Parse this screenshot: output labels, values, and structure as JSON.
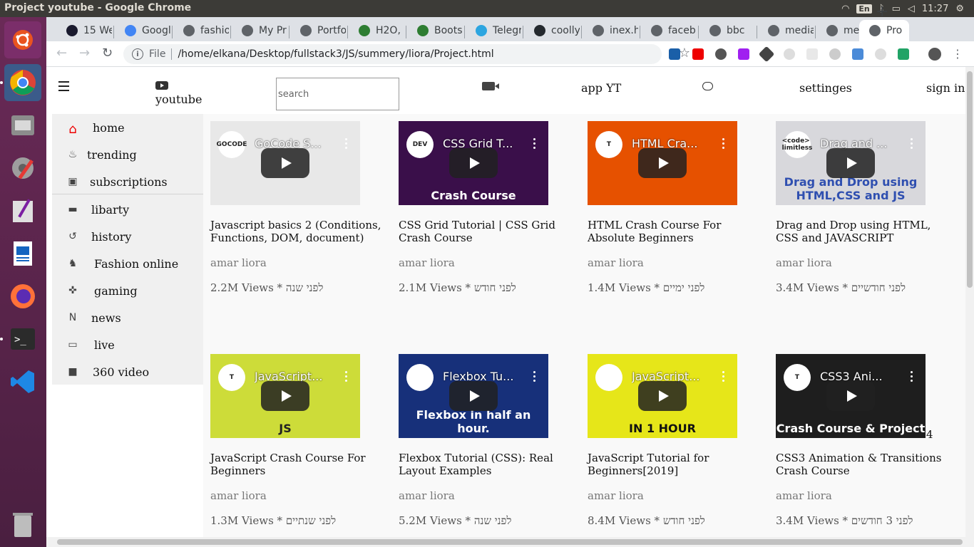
{
  "os": {
    "window_title": "Project youtube - Google Chrome",
    "keyboard": "En",
    "clock": "11:27"
  },
  "tabs": [
    {
      "label": "15 We",
      "color": "#1a1a2e"
    },
    {
      "label": "Googl",
      "color": "#4285f4"
    },
    {
      "label": "fashio",
      "color": "#5f6368"
    },
    {
      "label": "My Pr",
      "color": "#5f6368"
    },
    {
      "label": "Portfo",
      "color": "#5f6368"
    },
    {
      "label": "H2O, c",
      "color": "#2e7d32"
    },
    {
      "label": "Boots",
      "color": "#2e7d32"
    },
    {
      "label": "Telegr",
      "color": "#2ca5e0"
    },
    {
      "label": "coolly",
      "color": "#24292e"
    },
    {
      "label": "inex.h",
      "color": "#5f6368"
    },
    {
      "label": "faceb",
      "color": "#5f6368"
    },
    {
      "label": "bbc",
      "color": "#5f6368"
    },
    {
      "label": "media",
      "color": "#5f6368"
    },
    {
      "label": "media",
      "color": "#5f6368"
    },
    {
      "label": "Pro",
      "color": "#5f6368",
      "active": true
    }
  ],
  "omnibox": {
    "scheme": "File",
    "url": "/home/elkana/Desktop/fullstack3/JS/summery/liora/Project.html"
  },
  "page": {
    "logo_text": "youtube",
    "search_placeholder": "search",
    "nav": {
      "app": "app YT",
      "settings": "settinges",
      "signin": "sign in"
    },
    "sidebar": [
      {
        "label": "home",
        "icon": "home-icon"
      },
      {
        "label": "trending",
        "icon": "fire-icon"
      },
      {
        "label": "subscriptions",
        "icon": "subscriptions-icon"
      },
      {
        "label": "libarty",
        "icon": "folder-icon"
      },
      {
        "label": "history",
        "icon": "history-icon"
      },
      {
        "label": "Fashion online",
        "icon": "shirt-icon"
      },
      {
        "label": "gaming",
        "icon": "gamepad-icon"
      },
      {
        "label": "news",
        "icon": "news-icon"
      },
      {
        "label": "live",
        "icon": "monitor-icon"
      },
      {
        "label": "360 video",
        "icon": "video-camera-icon"
      }
    ],
    "videos": [
      {
        "thumb_title": "GoCode S...",
        "channel": "GOCODE",
        "thumb_sub": "",
        "title": "Javascript basics 2 (Conditions, Functions, DOM, document)",
        "author": "amar liora",
        "views": "2.2M Views * לפני שנה",
        "bg": "#e8e8e8",
        "sub_color": "#333"
      },
      {
        "thumb_title": "CSS Grid T...",
        "channel": "DEV",
        "thumb_sub": "Crash Course",
        "title": "CSS Grid Tutorial | CSS Grid Crash Course",
        "author": "amar liora",
        "views": "2.1M Views * לפני חודש",
        "bg": "#3a0f4a",
        "sub_color": "#fff"
      },
      {
        "thumb_title": "HTML Cra...",
        "channel": "T",
        "thumb_sub": "",
        "title": "HTML Crash Course For Absolute Beginners",
        "author": "amar liora",
        "views": "1.4M Views * לפני ימיים",
        "bg": "#e65100",
        "sub_color": "#fff"
      },
      {
        "thumb_title": "Drag and ...",
        "channel": "<code> limitless",
        "thumb_sub": "Drag and Drop using HTML,CSS and JS",
        "title": "Drag and Drop using HTML, CSS and JAVASCRIPT",
        "author": "amar liora",
        "views": "3.4M Views * לפני חודשיים",
        "bg": "#d8d8dc",
        "sub_color": "#2f4fb0"
      },
      {
        "thumb_title": "JavaScript...",
        "channel": "T",
        "thumb_sub": "JS",
        "title": "JavaScript Crash Course For Beginners",
        "author": "amar liora",
        "views": "1.3M Views * לפני שנתיים",
        "bg": "#cddc39",
        "sub_color": "#222"
      },
      {
        "thumb_title": "Flexbox Tu...",
        "channel": "",
        "thumb_sub": "Flexbox in half an hour.",
        "title": "Flexbox Tutorial (CSS): Real Layout Examples",
        "author": "amar liora",
        "views": "5.2M Views * לפני שנה",
        "bg": "#17307a",
        "sub_color": "#fff"
      },
      {
        "thumb_title": "JavaScript...",
        "channel": "",
        "thumb_sub": "IN 1 HOUR",
        "title": "JavaScript Tutorial for Beginners[2019]",
        "author": "amar liora",
        "views": "8.4M Views * לפני חודש",
        "bg": "#e6e619",
        "sub_color": "#111"
      },
      {
        "thumb_title": "CSS3 Ani...",
        "channel": "T",
        "thumb_sub": "Crash Course & Project",
        "title": "CSS3 Animation & Transitions Crash Course",
        "author": "amar liora",
        "views": "3.4M Views * לפני 3 חודשים",
        "bg": "#1e1e1e",
        "sub_color": "#fff",
        "extra": "4"
      }
    ]
  }
}
